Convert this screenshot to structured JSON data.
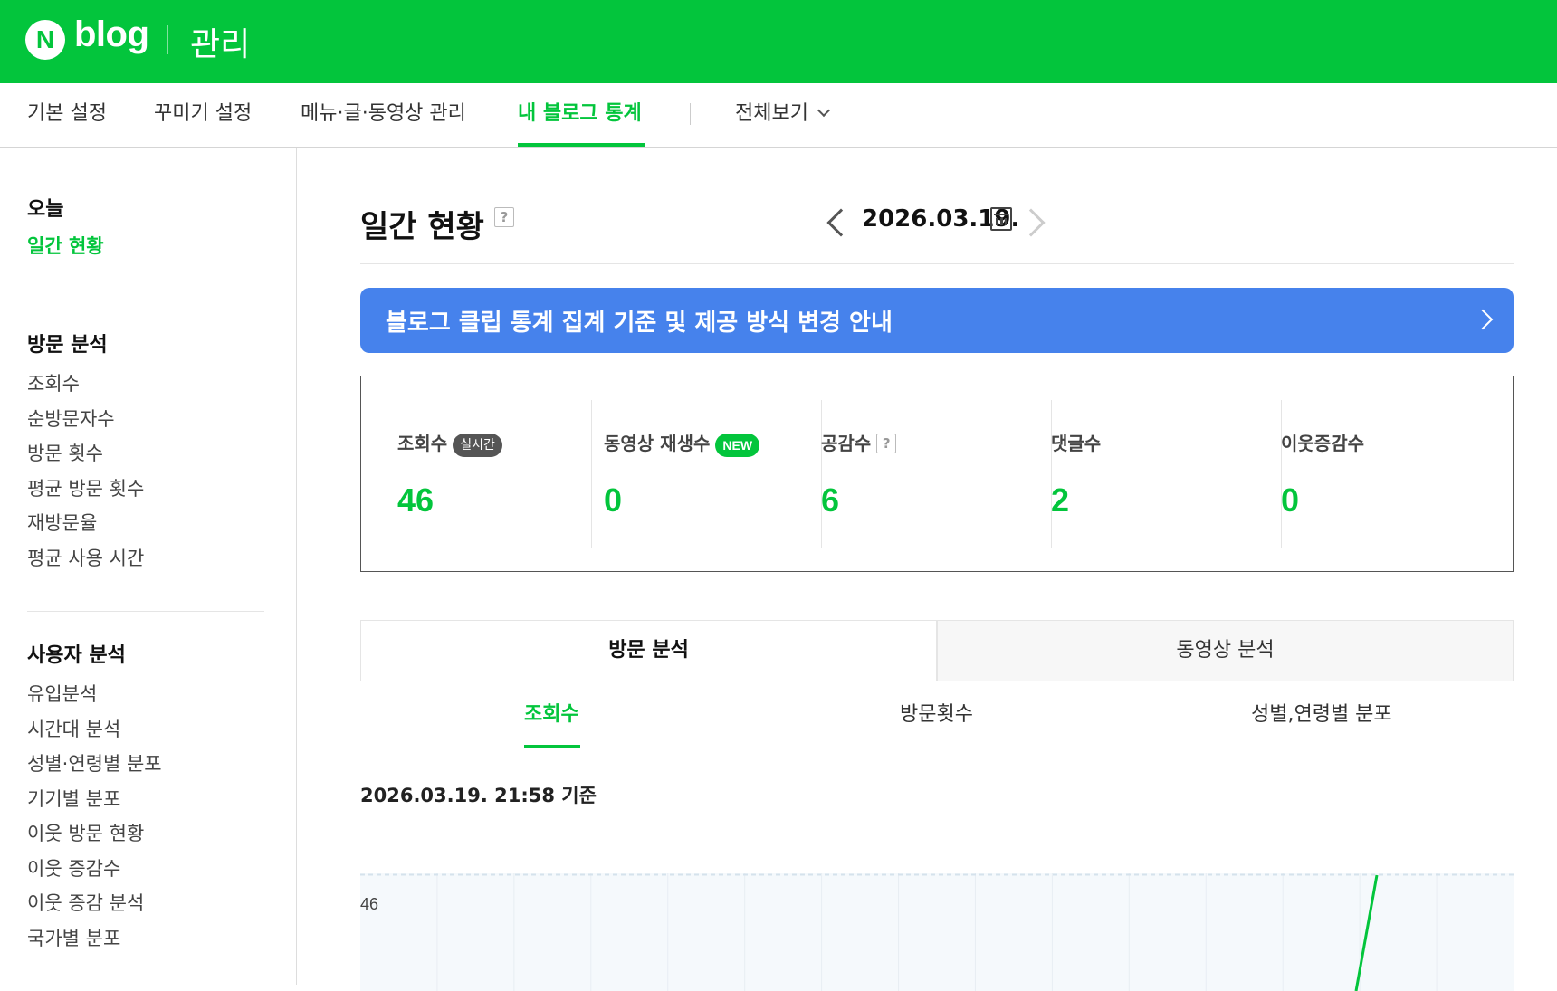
{
  "header": {
    "logo_n": "N",
    "logo_text": "blog",
    "section": "관리"
  },
  "nav": {
    "items": [
      {
        "label": "기본 설정"
      },
      {
        "label": "꾸미기 설정"
      },
      {
        "label": "메뉴·글·동영상 관리"
      },
      {
        "label": "내 블로그 통계"
      }
    ],
    "active_index": 3,
    "view_all": "전체보기"
  },
  "sidebar": {
    "today": {
      "heading": "오늘",
      "items": [
        {
          "label": "일간 현황",
          "active": true
        }
      ]
    },
    "visit": {
      "heading": "방문 분석",
      "items": [
        {
          "label": "조회수"
        },
        {
          "label": "순방문자수"
        },
        {
          "label": "방문 횟수"
        },
        {
          "label": "평균 방문 횟수"
        },
        {
          "label": "재방문율"
        },
        {
          "label": "평균 사용 시간"
        }
      ]
    },
    "user": {
      "heading": "사용자 분석",
      "items": [
        {
          "label": "유입분석"
        },
        {
          "label": "시간대 분석"
        },
        {
          "label": "성별·연령별 분포"
        },
        {
          "label": "기기별 분포"
        },
        {
          "label": "이웃 방문 현황"
        },
        {
          "label": "이웃 증감수"
        },
        {
          "label": "이웃 증감 분석"
        },
        {
          "label": "국가별 분포"
        }
      ]
    }
  },
  "main": {
    "title": "일간 현황",
    "help": "?",
    "date": "2026.03.19.",
    "banner": "블로그 클립 통계 집계 기준 및 제공 방식 변경 안내",
    "stats": [
      {
        "label": "조회수",
        "badge": "실시간",
        "value": "46"
      },
      {
        "label": "동영상 재생수",
        "badge": "NEW",
        "value": "0"
      },
      {
        "label": "공감수",
        "help": "?",
        "value": "6"
      },
      {
        "label": "댓글수",
        "value": "2"
      },
      {
        "label": "이웃증감수",
        "value": "0"
      }
    ],
    "tabs": [
      {
        "label": "방문 분석",
        "active": true
      },
      {
        "label": "동영상 분석",
        "active": false
      }
    ],
    "subtabs": [
      {
        "label": "조회수",
        "active": true
      },
      {
        "label": "방문횟수",
        "active": false
      },
      {
        "label": "성별,연령별 분포",
        "active": false
      }
    ],
    "basis": "2026.03.19. 21:58 기준"
  },
  "chart_data": {
    "type": "line",
    "y_tick_labels": [
      "46"
    ],
    "max_value": 46,
    "line_color": "#03c53c",
    "grid_color": "#e8eef3",
    "background": "#f5f9fc",
    "grid": true
  },
  "colors": {
    "brand_green": "#03c53c",
    "banner_blue": "#4682ec"
  }
}
